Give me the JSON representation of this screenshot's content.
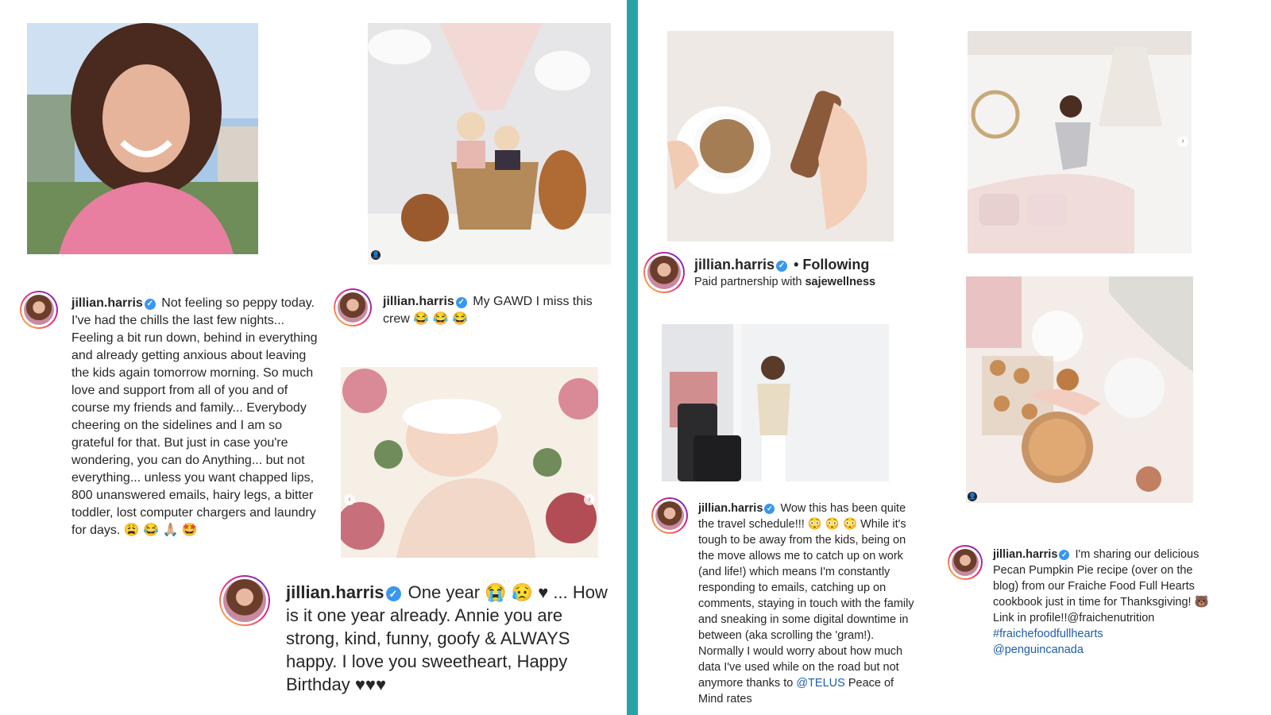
{
  "posts": {
    "selfie": {
      "username": "jillian.harris",
      "text": "Not feeling so peppy today. I've had the chills the last few nights... Feeling a bit run down, behind in everything and already getting anxious about leaving the kids again tomorrow morning. So much love and support from all of you and of course my friends and family... Everybody cheering on the sidelines and I am so grateful for that. But just in case you're wondering, you can do Anything... but not everything... unless you want chapped lips, 800 unanswered emails, hairy legs, a bitter toddler, lost computer chargers and laundry for days. 😩 😂 🙏🏼 🤩"
    },
    "kids_dogs": {
      "username": "jillian.harris",
      "text": "My GAWD I miss this crew 😂 😂 😂"
    },
    "birthday": {
      "username": "jillian.harris",
      "text": "One year 😭 😥 ♥ ... How is it one year already. Annie you are strong, kind, funny, goofy & ALWAYS happy. I love you sweetheart, Happy Birthday ♥♥♥"
    },
    "saje": {
      "username": "jillian.harris",
      "following": "• Following",
      "paid_prefix": "Paid partnership with",
      "partner": "sajewellness"
    },
    "travel": {
      "username": "jillian.harris",
      "text_before": "Wow this has been quite the travel schedule!!! 😳 😳 😳  While it's tough to be away from the kids, being on the move allows me to catch up on work (and life!) which means I'm constantly responding to emails, catching up on comments, staying in touch with the family and sneaking in some digital downtime in between (aka scrolling the 'gram!). Normally I would worry about how much data I've used while on the road but not anymore thanks to",
      "mention": "@TELUS",
      "text_after": "Peace of Mind rates"
    },
    "pie": {
      "username": "jillian.harris",
      "text": "I'm sharing our delicious Pecan Pumpkin Pie recipe (over on the blog) from our Fraiche Food Full Hearts cookbook just in time for Thanksgiving! 🐻 Link in profile!!@fraichenutrition",
      "hashtag": "#fraichefoodfullhearts",
      "mention": "@penguincanada"
    }
  },
  "icons": {
    "verified": "✓",
    "arrow_left": "‹",
    "arrow_right": "›",
    "tag": "👤"
  },
  "colors": {
    "divider": "#27a3a6",
    "verified": "#3897f0",
    "link": "#1d5ea8"
  }
}
